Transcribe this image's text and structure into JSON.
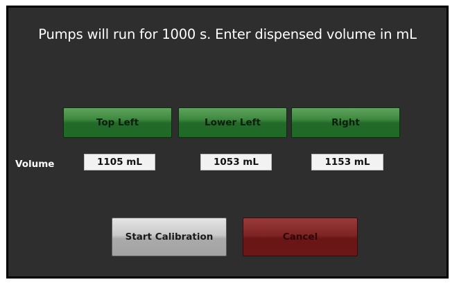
{
  "dialog": {
    "title": "Pumps will run for 1000 s. Enter dispensed volume in mL"
  },
  "pumps": [
    {
      "label": "Top Left",
      "volume": "1105 mL"
    },
    {
      "label": "Lower Left",
      "volume": "1053 mL"
    },
    {
      "label": "Right",
      "volume": "1153 mL"
    }
  ],
  "volume_label": "Volume",
  "actions": {
    "start_label": "Start Calibration",
    "cancel_label": "Cancel"
  },
  "colors": {
    "background": "#2e2e2e",
    "pump_button": "#2f7d33",
    "start_button": "#bdbdbd",
    "cancel_button": "#7e2424"
  }
}
